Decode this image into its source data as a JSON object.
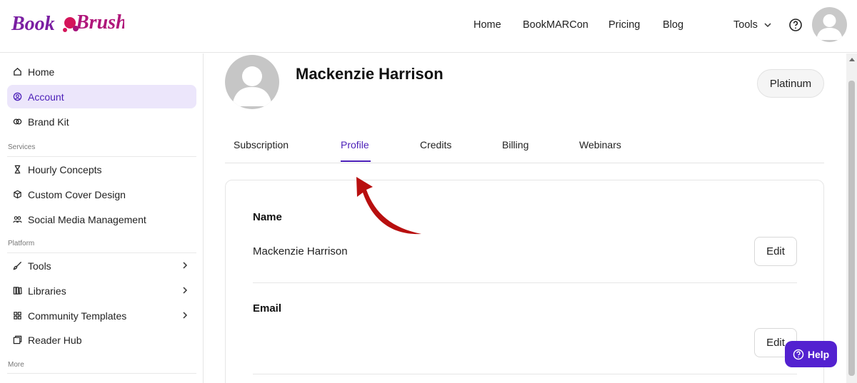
{
  "brand": {
    "logo_text": "BookBrush",
    "logo_color": "#7a1fa2",
    "splash_color": "#d4145a"
  },
  "topnav": {
    "home": "Home",
    "bookmarcon": "BookMARCon",
    "pricing": "Pricing",
    "blog": "Blog",
    "tools": "Tools"
  },
  "sidebar": {
    "items_top": [
      {
        "label": "Home",
        "icon": "home-icon"
      },
      {
        "label": "Account",
        "icon": "account-icon",
        "active": true
      },
      {
        "label": "Brand Kit",
        "icon": "brand-kit-icon"
      }
    ],
    "section_services": "Services",
    "items_services": [
      {
        "label": "Hourly Concepts",
        "icon": "hourglass-icon"
      },
      {
        "label": "Custom Cover Design",
        "icon": "cube-icon"
      },
      {
        "label": "Social Media Management",
        "icon": "people-icon"
      }
    ],
    "section_platform": "Platform",
    "items_platform": [
      {
        "label": "Tools",
        "icon": "brush-icon",
        "chevron": true
      },
      {
        "label": "Libraries",
        "icon": "library-icon",
        "chevron": true
      },
      {
        "label": "Community Templates",
        "icon": "grid-icon",
        "chevron": true
      },
      {
        "label": "Reader Hub",
        "icon": "window-icon"
      }
    ],
    "section_more": "More"
  },
  "profile": {
    "name": "Mackenzie Harrison",
    "plan": "Platinum"
  },
  "tabs": [
    "Subscription",
    "Profile",
    "Credits",
    "Billing",
    "Webinars"
  ],
  "active_tab": "Profile",
  "card": {
    "name_label": "Name",
    "name_value": "Mackenzie Harrison",
    "email_label": "Email",
    "email_value": "",
    "edit_label": "Edit"
  },
  "help_button": "Help",
  "colors": {
    "accent": "#4b1fb8",
    "help_bg": "#5321d0",
    "arrow": "#b80f0f",
    "active_bg": "#ece6fb"
  }
}
